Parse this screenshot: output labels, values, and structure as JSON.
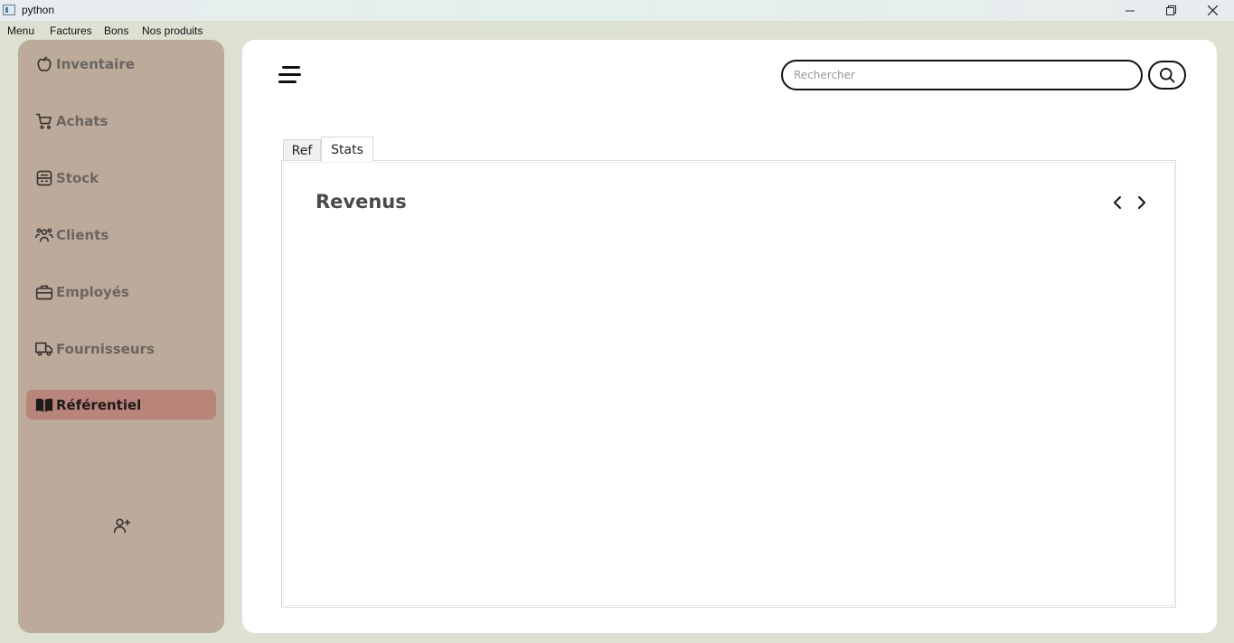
{
  "window": {
    "title": "python",
    "minimize_glyph": "—",
    "maximize_glyph": "❐",
    "close_glyph": "✕"
  },
  "menubar": {
    "items": [
      "Menu",
      "Factures",
      "Bons",
      "Nos produits"
    ]
  },
  "sidebar": {
    "items": [
      {
        "label": "Inventaire",
        "icon": "apple-icon"
      },
      {
        "label": "Achats",
        "icon": "cart-icon"
      },
      {
        "label": "Stock",
        "icon": "warehouse-icon"
      },
      {
        "label": "Clients",
        "icon": "users-icon"
      },
      {
        "label": "Employés",
        "icon": "briefcase-icon"
      },
      {
        "label": "Fournisseurs",
        "icon": "truck-icon"
      },
      {
        "label": "Référentiel",
        "icon": "book-icon",
        "active": true
      }
    ],
    "add_user_icon": "user-plus-icon"
  },
  "header": {
    "search_placeholder": "Rechercher",
    "search_value": ""
  },
  "tabs": [
    {
      "label": "Ref",
      "selected": false
    },
    {
      "label": "Stats",
      "selected": true
    }
  ],
  "panel": {
    "title": "Revenus"
  },
  "colors": {
    "background": "#dde1d2",
    "sidebar": "#bcab9b",
    "active_item": "#b9847a",
    "inactive_label": "#6b6560"
  }
}
